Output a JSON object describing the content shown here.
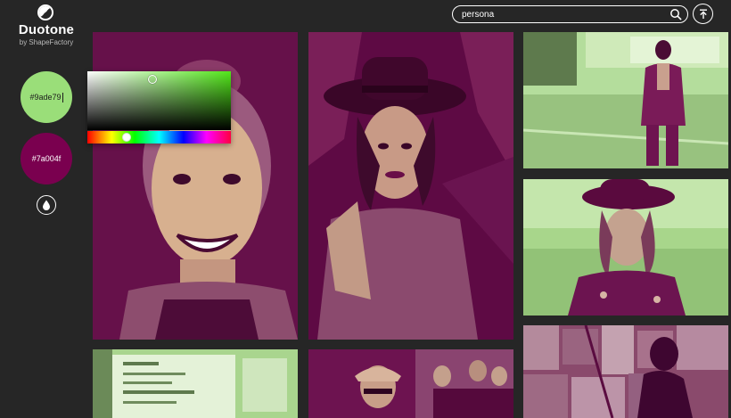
{
  "brand": {
    "title": "Duotone",
    "subtitle": "by ShapeFactory"
  },
  "swatches": {
    "light": {
      "hex": "#9ade79"
    },
    "dark": {
      "hex": "#7a004f"
    }
  },
  "colors": {
    "light": "#9ade79",
    "dark": "#7a004f",
    "background": "#262626"
  },
  "search": {
    "value": "persona"
  },
  "icons": [
    "logo-icon",
    "drop-icon",
    "search-icon",
    "upload-icon"
  ],
  "gallery": [
    {
      "name": "photo-smiling-woman"
    },
    {
      "name": "photo-woman-in-hat"
    },
    {
      "name": "photo-man-in-suit"
    },
    {
      "name": "photo-woman-at-beach"
    },
    {
      "name": "photo-whiteboard-notes"
    },
    {
      "name": "photo-street-crowd"
    },
    {
      "name": "photo-poster-wall"
    }
  ]
}
